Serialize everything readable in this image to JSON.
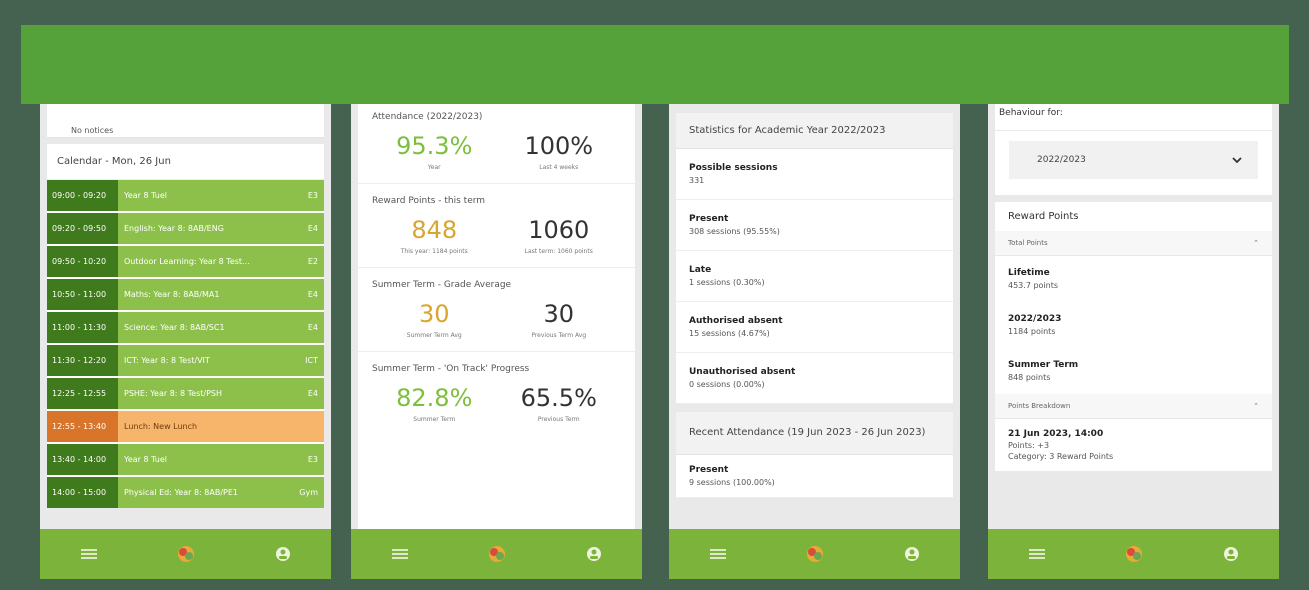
{
  "phone1": {
    "notice": "No notices",
    "calendar_title": "Calendar - Mon, 26 Jun",
    "rows": [
      {
        "time": "09:00 - 09:20",
        "subject": "Year 8 Tuel",
        "room": "E3"
      },
      {
        "time": "09:20 - 09:50",
        "subject": "English: Year 8: 8AB/ENG",
        "room": "E4"
      },
      {
        "time": "09:50 - 10:20",
        "subject": "Outdoor Learning: Year 8 Test...",
        "room": "E2"
      },
      {
        "time": "10:50 - 11:00",
        "subject": "Maths: Year 8: 8AB/MA1",
        "room": "E4"
      },
      {
        "time": "11:00 - 11:30",
        "subject": "Science: Year 8: 8AB/SC1",
        "room": "E4"
      },
      {
        "time": "11:30 - 12:20",
        "subject": "ICT: Year 8: 8 Test/VIT",
        "room": "ICT"
      },
      {
        "time": "12:25 - 12:55",
        "subject": "PSHE: Year 8: 8 Test/PSH",
        "room": "E4"
      },
      {
        "time": "12:55 - 13:40",
        "subject": "Lunch: New Lunch",
        "room": ""
      },
      {
        "time": "13:40 - 14:00",
        "subject": "Year 8 Tuel",
        "room": "E3"
      },
      {
        "time": "14:00 - 15:00",
        "subject": "Physical Ed: Year 8: 8AB/PE1",
        "room": "Gym"
      }
    ]
  },
  "phone2": {
    "attendance_title": "Attendance (2022/2023)",
    "att_main": "95.3%",
    "att_main_cap": "Year",
    "att_second": "100%",
    "att_second_cap": "Last 4 weeks",
    "reward_title": "Reward Points - this term",
    "reward_main": "848",
    "reward_main_cap": "This year: 1184 points",
    "reward_second": "1060",
    "reward_second_cap": "Last term: 1060 points",
    "grade_title": "Summer Term - Grade Average",
    "grade_main": "30",
    "grade_main_cap": "Summer Term Avg",
    "grade_second": "30",
    "grade_second_cap": "Previous Term Avg",
    "track_title": "Summer Term - 'On Track' Progress",
    "track_main": "82.8%",
    "track_main_cap": "Summer Term",
    "track_second": "65.5%",
    "track_second_cap": "Previous Term"
  },
  "phone3": {
    "stats_title": "Statistics for Academic Year 2022/2023",
    "items": [
      {
        "label": "Possible sessions",
        "value": "331"
      },
      {
        "label": "Present",
        "value": "308 sessions (95.55%)"
      },
      {
        "label": "Late",
        "value": "1 sessions (0.30%)"
      },
      {
        "label": "Authorised absent",
        "value": "15 sessions (4.67%)"
      },
      {
        "label": "Unauthorised absent",
        "value": "0 sessions (0.00%)"
      }
    ],
    "recent_title": "Recent Attendance (19 Jun 2023 - 26 Jun 2023)",
    "recent_label": "Present",
    "recent_value": "9 sessions (100.00%)"
  },
  "phone4": {
    "behaviour_label": "Behaviour for:",
    "year_select": "2022/2023",
    "reward_title": "Reward Points",
    "total_points": "Total Points",
    "items": [
      {
        "label": "Lifetime",
        "value": "453.7 points"
      },
      {
        "label": "2022/2023",
        "value": "1184 points"
      },
      {
        "label": "Summer Term",
        "value": "848 points"
      }
    ],
    "breakdown": "Points Breakdown",
    "entry_date": "21 Jun 2023, 14:00",
    "entry_points": "Points: +3",
    "entry_category": "Category: 3 Reward Points"
  },
  "colors": {
    "accent_green": "#7cb33a",
    "orange_value": "#d8a52e",
    "green_value": "#7cbf3a"
  }
}
